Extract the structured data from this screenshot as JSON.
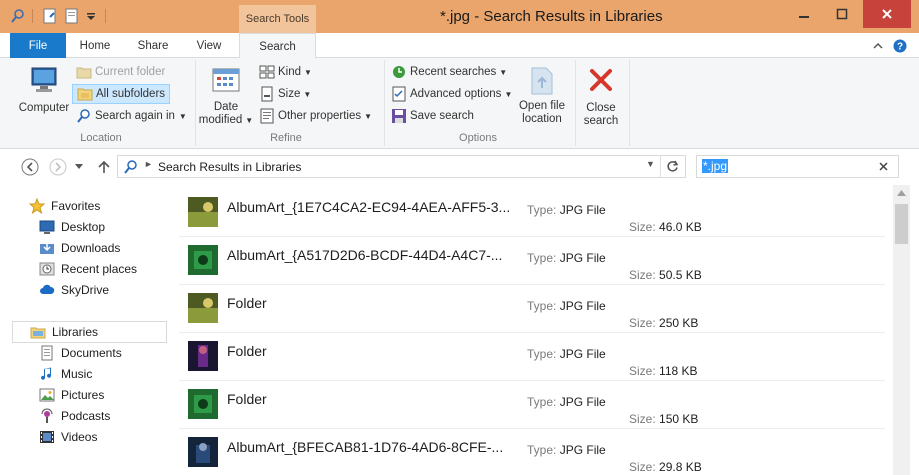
{
  "window": {
    "title": "*.jpg - Search Results in Libraries",
    "context_tab": "Search Tools"
  },
  "tabs": {
    "file": "File",
    "home": "Home",
    "share": "Share",
    "view": "View",
    "search": "Search"
  },
  "ribbon": {
    "location": {
      "computer": "Computer",
      "current_folder": "Current folder",
      "all_subfolders": "All subfolders",
      "search_again_in": "Search again in",
      "label": "Location"
    },
    "refine": {
      "date_modified_1": "Date",
      "date_modified_2": "modified",
      "kind": "Kind",
      "size": "Size",
      "other_properties": "Other properties",
      "label": "Refine"
    },
    "options": {
      "recent_searches": "Recent searches",
      "advanced_options": "Advanced options",
      "save_search": "Save search",
      "open_file_location_1": "Open file",
      "open_file_location_2": "location",
      "label": "Options"
    },
    "close": {
      "line1": "Close",
      "line2": "search"
    }
  },
  "address": {
    "breadcrumb": "Search Results in Libraries"
  },
  "search": {
    "query": "*.jpg"
  },
  "sidebar": {
    "favorites": "Favorites",
    "desktop": "Desktop",
    "downloads": "Downloads",
    "recent_places": "Recent places",
    "skydrive": "SkyDrive",
    "libraries": "Libraries",
    "documents": "Documents",
    "music": "Music",
    "pictures": "Pictures",
    "podcasts": "Podcasts",
    "videos": "Videos"
  },
  "labels": {
    "type": "Type:",
    "size": "Size:"
  },
  "files": [
    {
      "name": "AlbumArt_{1E7C4CA2-EC94-4AEA-AFF5-3...",
      "type": "JPG File",
      "size": "46.0 KB"
    },
    {
      "name": "AlbumArt_{A517D2D6-BCDF-44D4-A4C7-...",
      "type": "JPG File",
      "size": "50.5 KB"
    },
    {
      "name": "Folder",
      "type": "JPG File",
      "size": "250 KB"
    },
    {
      "name": "Folder",
      "type": "JPG File",
      "size": "118 KB"
    },
    {
      "name": "Folder",
      "type": "JPG File",
      "size": "150 KB"
    },
    {
      "name": "AlbumArt_{BFECAB81-1D76-4AD6-8CFE-...",
      "type": "JPG File",
      "size": "29.8 KB"
    }
  ],
  "colors": {
    "titlebar": "#e9a56b",
    "file_tab": "#1979ca",
    "close_button": "#c7423a",
    "selection": "#cce8ff"
  }
}
